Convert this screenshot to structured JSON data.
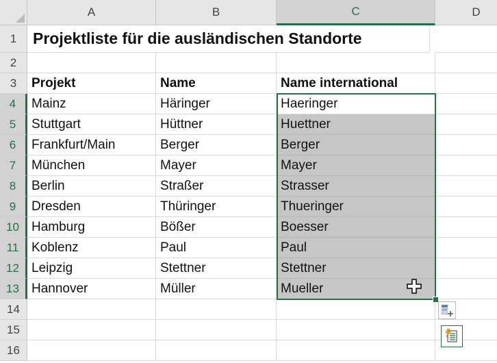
{
  "columns": [
    "A",
    "B",
    "C",
    "D"
  ],
  "rows": [
    "1",
    "2",
    "3",
    "4",
    "5",
    "6",
    "7",
    "8",
    "9",
    "10",
    "11",
    "12",
    "13",
    "14",
    "15",
    "16"
  ],
  "title": "Projektliste für die ausländischen Standorte",
  "headers": {
    "a": "Projekt",
    "b": "Name",
    "c": "Name international"
  },
  "data": [
    {
      "a": "Mainz",
      "b": "Häringer",
      "c": "Haeringer"
    },
    {
      "a": "Stuttgart",
      "b": "Hüttner",
      "c": "Huettner"
    },
    {
      "a": "Frankfurt/Main",
      "b": "Berger",
      "c": "Berger"
    },
    {
      "a": "München",
      "b": "Mayer",
      "c": "Mayer"
    },
    {
      "a": "Berlin",
      "b": "Straßer",
      "c": "Strasser"
    },
    {
      "a": "Dresden",
      "b": "Thüringer",
      "c": "Thueringer"
    },
    {
      "a": "Hamburg",
      "b": "Bößer",
      "c": "Boesser"
    },
    {
      "a": "Koblenz",
      "b": "Paul",
      "c": "Paul"
    },
    {
      "a": "Leipzig",
      "b": "Stettner",
      "c": "Stettner"
    },
    {
      "a": "Hannover",
      "b": "Müller",
      "c": "Mueller"
    }
  ],
  "colors": {
    "accent": "#217346",
    "selection": "#c6c6c6",
    "header_bg": "#e6e6e6"
  },
  "icons": [
    "select-all-triangle-icon",
    "move-cursor-icon",
    "quick-analysis-icon",
    "flash-fill-icon"
  ]
}
